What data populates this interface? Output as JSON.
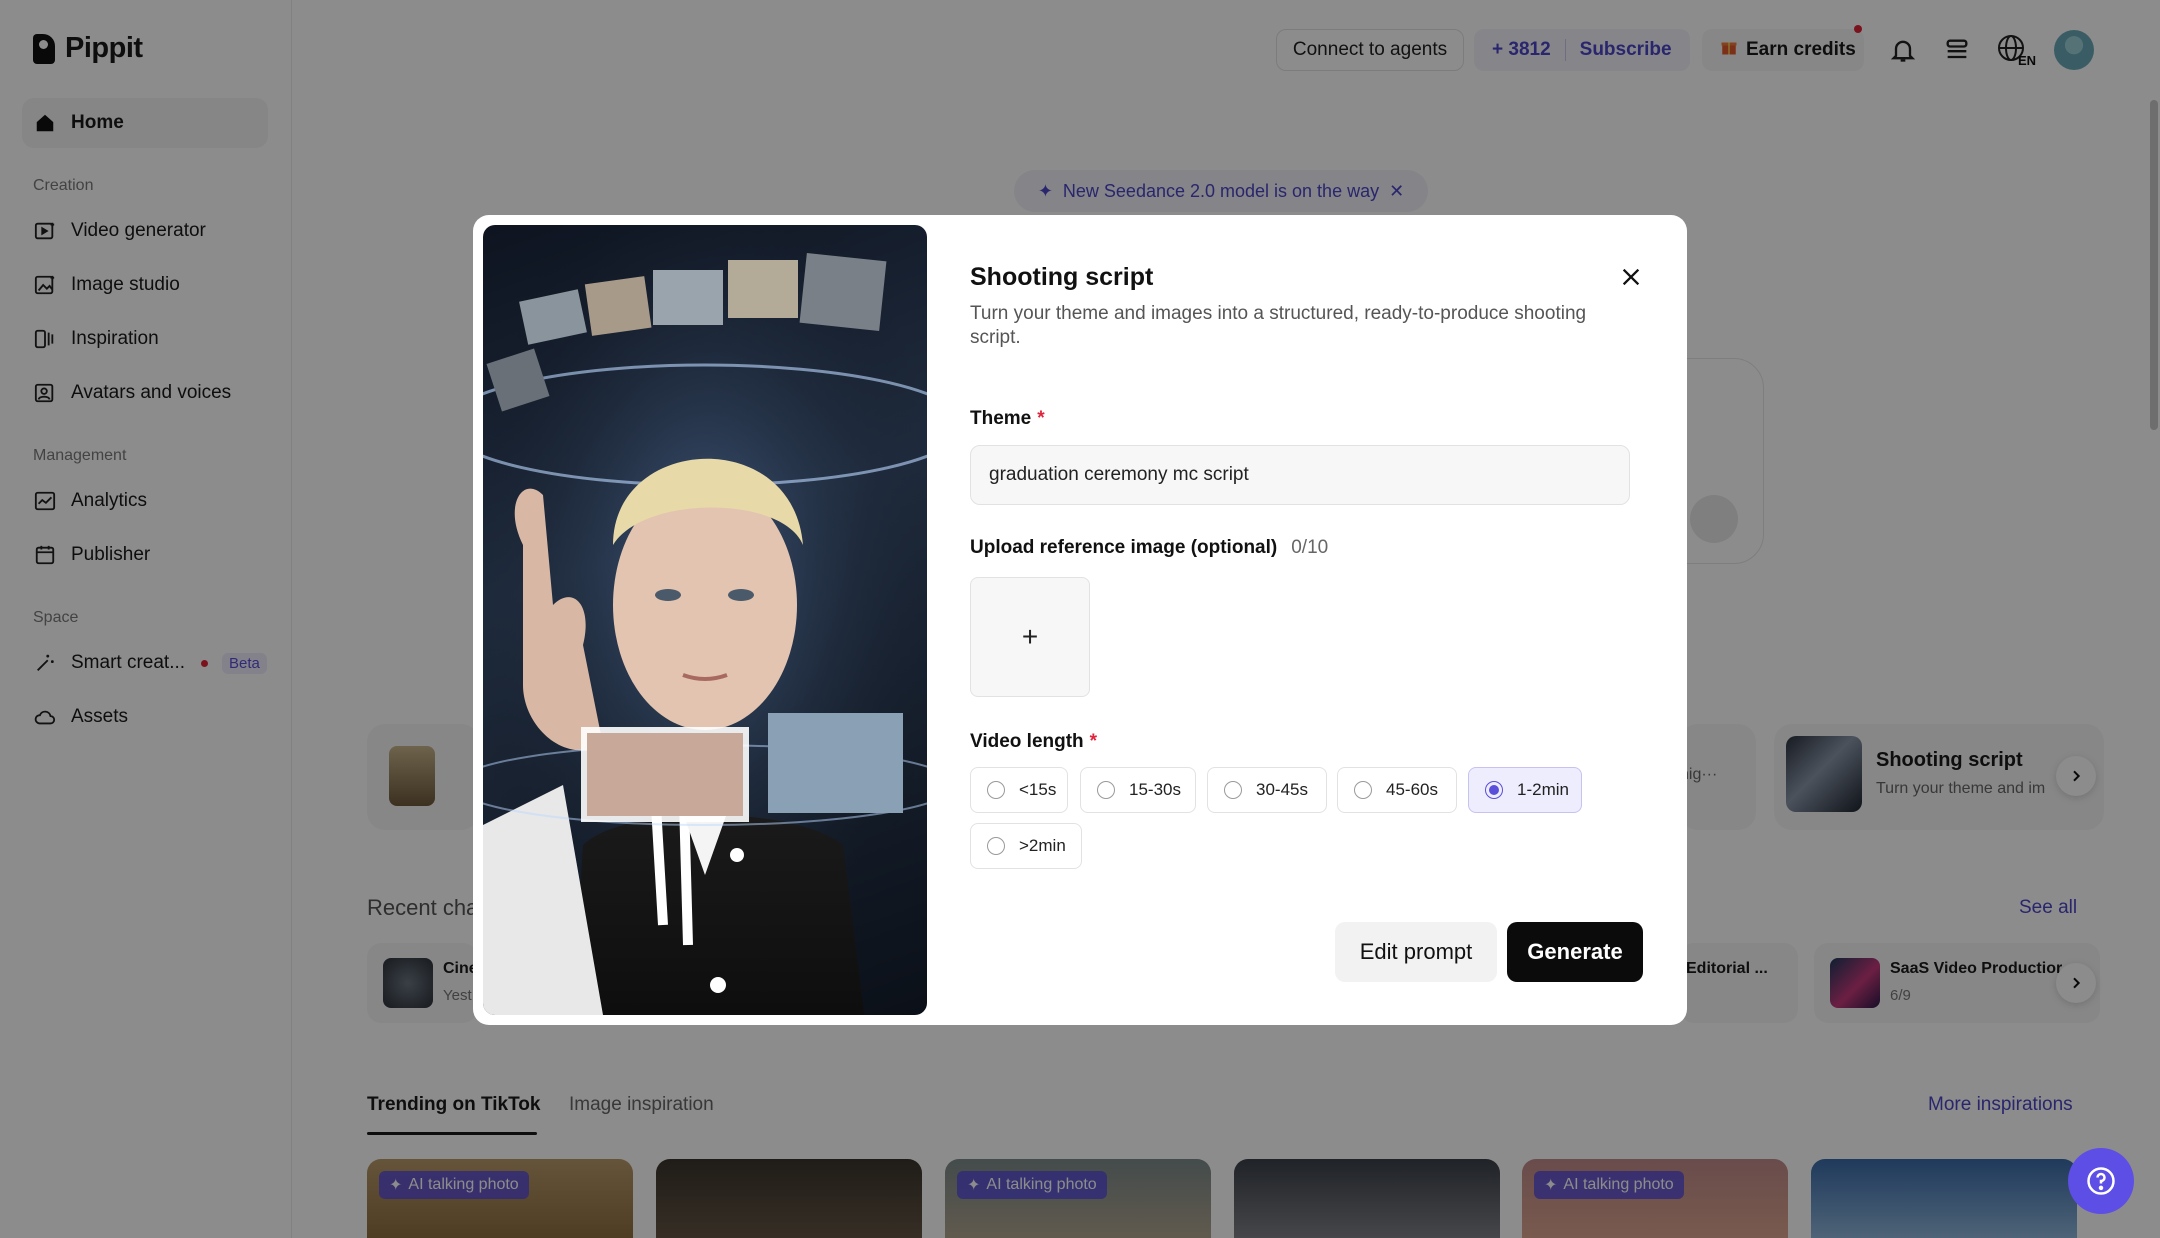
{
  "sidebar": {
    "logo": "Pippit",
    "home": "Home",
    "section_creation": "Creation",
    "video_generator": "Video generator",
    "image_studio": "Image studio",
    "inspiration": "Inspiration",
    "avatars_voices": "Avatars and voices",
    "section_management": "Management",
    "analytics": "Analytics",
    "publisher": "Publisher",
    "section_space": "Space",
    "smart_creation": "Smart creat...",
    "beta": "Beta",
    "assets": "Assets"
  },
  "topbar": {
    "connect": "Connect to agents",
    "credits_value": "+ 3812",
    "subscribe": "Subscribe",
    "earn": "Earn credits",
    "lang": "EN"
  },
  "main": {
    "announcement": "New Seedance 2.0 model is on the way",
    "tool_title": "Shooting script",
    "tool_sub": "Turn your theme and im",
    "tool_partial": "hig···",
    "recent_title": "Recent cha",
    "see_all": "See all",
    "recent_left_title": "Cine",
    "recent_left_sub": "Yest",
    "recent_mid_title": "Editorial ...",
    "recent_right_title": "SaaS Video Productior",
    "recent_right_sub": "6/9",
    "tab_trending": "Trending on TikTok",
    "tab_image": "Image inspiration",
    "more_inspirations": "More inspirations",
    "badge": "AI talking photo"
  },
  "modal": {
    "title": "Shooting script",
    "subtitle": "Turn your theme and images into a structured, ready-to-produce shooting script.",
    "theme_label": "Theme",
    "theme_value": "graduation ceremony mc script",
    "upload_label": "Upload reference image (optional)",
    "upload_count": "0/10",
    "video_length_label": "Video length",
    "options": [
      "<15s",
      "15-30s",
      "30-45s",
      "45-60s",
      "1-2min",
      ">2min"
    ],
    "selected_option": "1-2min",
    "edit_prompt": "Edit prompt",
    "generate": "Generate"
  },
  "colors": {
    "accent": "#5a4fd8",
    "required": "#e0243a",
    "primary_button": "#0b0b0b"
  }
}
